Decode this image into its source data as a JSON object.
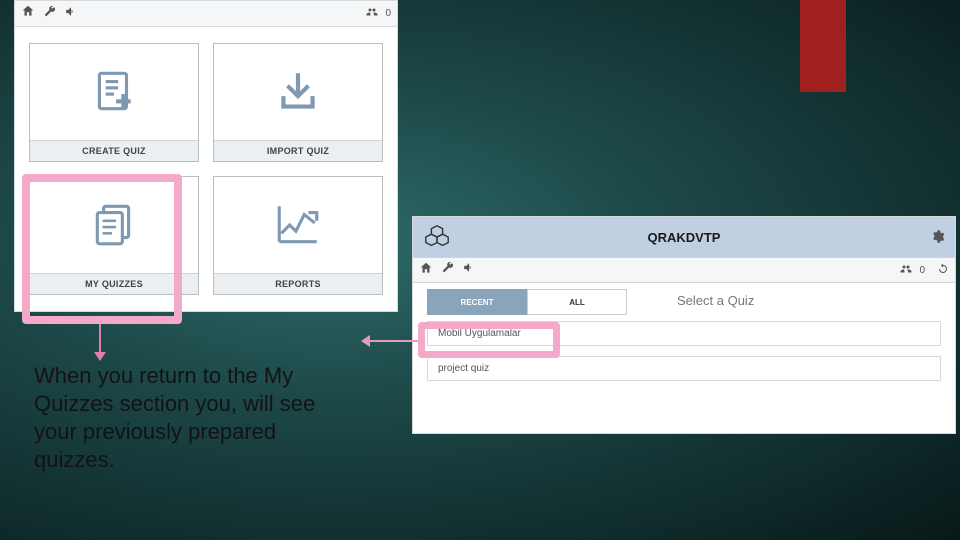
{
  "ribbon_color": "#a02020",
  "leftPanel": {
    "topbar": {
      "userCount": "0"
    },
    "tiles": {
      "createQuiz": "CREATE QUIZ",
      "importQuiz": "IMPORT QUIZ",
      "myQuizzes": "MY QUIZZES",
      "reports": "REPORTS"
    }
  },
  "caption": "When you return to the My Quizzes section you, will see your previously prepared quizzes.",
  "rightPanel": {
    "title": "QRAKDVTP",
    "toolbar": {
      "userCount": "0"
    },
    "tabs": {
      "recent": "RECENT",
      "all": "ALL"
    },
    "selectPrompt": "Select a Quiz",
    "items": [
      "Mobil Uygulamalar",
      "project quiz"
    ]
  }
}
